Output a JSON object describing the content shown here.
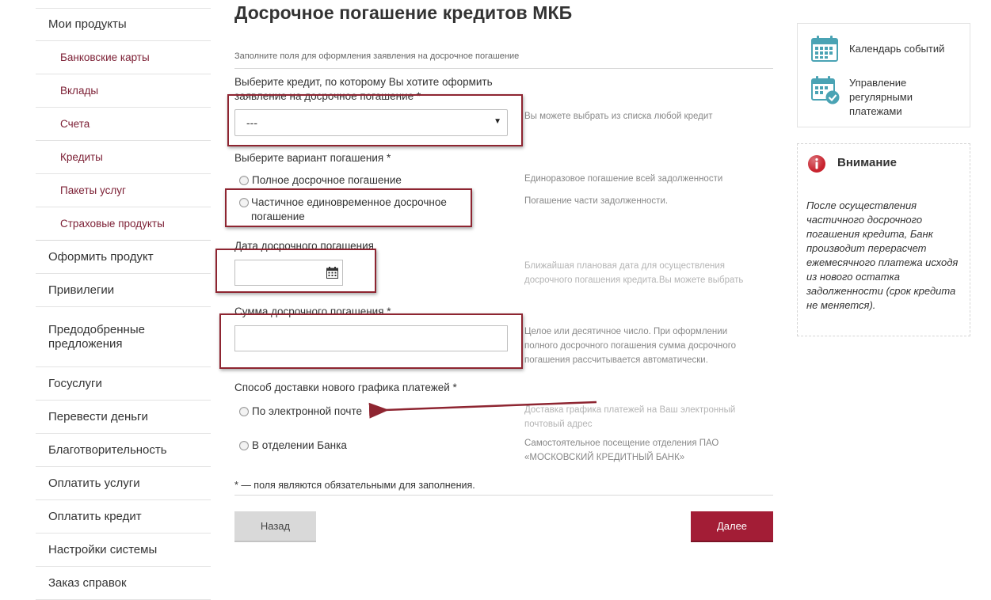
{
  "sidebar": {
    "items": [
      {
        "label": "Мои продукты",
        "type": "top"
      },
      {
        "label": "Банковские карты",
        "type": "sub"
      },
      {
        "label": "Вклады",
        "type": "sub"
      },
      {
        "label": "Счета",
        "type": "sub"
      },
      {
        "label": "Кредиты",
        "type": "sub"
      },
      {
        "label": "Пакеты услуг",
        "type": "sub"
      },
      {
        "label": "Страховые продукты",
        "type": "sub"
      },
      {
        "label": "Оформить продукт",
        "type": "top"
      },
      {
        "label": "Привилегии",
        "type": "top"
      },
      {
        "label": "Предодобренные предложения",
        "type": "top"
      },
      {
        "label": "Госуслуги",
        "type": "top"
      },
      {
        "label": "Перевести деньги",
        "type": "top"
      },
      {
        "label": "Благотворительность",
        "type": "top"
      },
      {
        "label": "Оплатить услуги",
        "type": "top"
      },
      {
        "label": "Оплатить кредит",
        "type": "top"
      },
      {
        "label": "Настройки системы",
        "type": "top"
      },
      {
        "label": "Заказ справок",
        "type": "top"
      }
    ]
  },
  "page": {
    "title": "Досрочное погашение кредитов МКБ",
    "subtitle": "Заполните поля для оформления заявления на досрочное погашение"
  },
  "form": {
    "credit": {
      "label": "Выберите кредит, по которому Вы хотите оформить заявление на досрочное погашение *",
      "value": "---",
      "hint": "Вы можете выбрать из списка любой кредит"
    },
    "variant": {
      "label": "Выберите вариант погашения *",
      "options": [
        {
          "label": "Полное досрочное погашение",
          "hint": "Единоразовое погашение всей задолженности"
        },
        {
          "label": "Частичное единовременное досрочное погашение",
          "hint": "Погашение части задолженности."
        }
      ]
    },
    "date": {
      "label": "Дата досрочного погашения",
      "hint": "Ближайшая плановая дата для осуществления досрочного погашения кредита.Вы можете выбрать"
    },
    "amount": {
      "label": "Сумма досрочного погашения *",
      "hint": "Целое или десятичное число. При оформлении полного досрочного погашения сумма досрочного погашения рассчитывается автоматически."
    },
    "delivery": {
      "label": "Способ доставки нового графика платежей *",
      "options": [
        {
          "label": "По электронной почте",
          "hint": "Доставка графика платежей на Ваш электронный почтовый адрес"
        },
        {
          "label": "В отделении Банка",
          "hint": "Самостоятельное посещение отделения ПАО «МОСКОВСКИЙ КРЕДИТНЫЙ БАНК»"
        }
      ]
    },
    "required_note": "* — поля являются обязательными для заполнения.",
    "back_label": "Назад",
    "next_label": "Далее"
  },
  "side": {
    "links": [
      {
        "label": "Календарь событий",
        "icon": "calendar-icon"
      },
      {
        "label": "Управление регулярными платежами",
        "icon": "calendar-check-icon"
      }
    ],
    "warning": {
      "title": "Внимание",
      "text": "После осуществления частичного досрочного погашения кредита, Банк производит перерасчет ежемесячного платежа исходя из нового остатка задолженности (срок кредита не меняется)."
    }
  },
  "colors": {
    "brand": "#a31d36",
    "sidebar_sub": "#7d2136",
    "annotation": "#8e2531",
    "icon_teal": "#4aa3b4"
  }
}
